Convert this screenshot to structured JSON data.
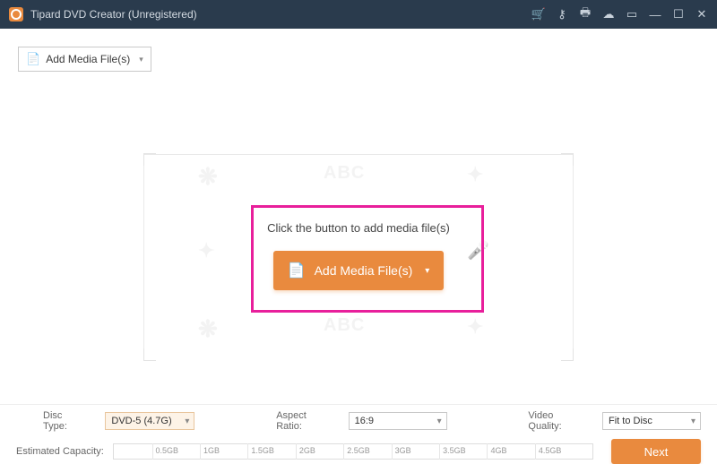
{
  "titlebar": {
    "title": "Tipard DVD Creator (Unregistered)",
    "icons": {
      "cart": "shopping-cart",
      "key": "register-key",
      "print": "print",
      "pref": "preferences",
      "help": "help",
      "minimize": "minimize",
      "maximize": "maximize",
      "close": "close"
    }
  },
  "toolbar": {
    "add_top_label": "Add Media File(s)"
  },
  "center": {
    "prompt": "Click the button to add media file(s)",
    "big_button_label": "Add Media File(s)"
  },
  "bottom": {
    "disc_type_label": "Disc Type:",
    "disc_type_value": "DVD-5 (4.7G)",
    "aspect_label": "Aspect Ratio:",
    "aspect_value": "16:9",
    "quality_label": "Video Quality:",
    "quality_value": "Fit to Disc",
    "capacity_label": "Estimated Capacity:",
    "ticks": [
      "0.5GB",
      "1GB",
      "1.5GB",
      "2GB",
      "2.5GB",
      "3GB",
      "3.5GB",
      "4GB",
      "4.5GB"
    ],
    "next_label": "Next"
  },
  "colors": {
    "accent": "#e98a3e",
    "highlight": "#e81f9b",
    "titlebar": "#2a3b4d"
  }
}
